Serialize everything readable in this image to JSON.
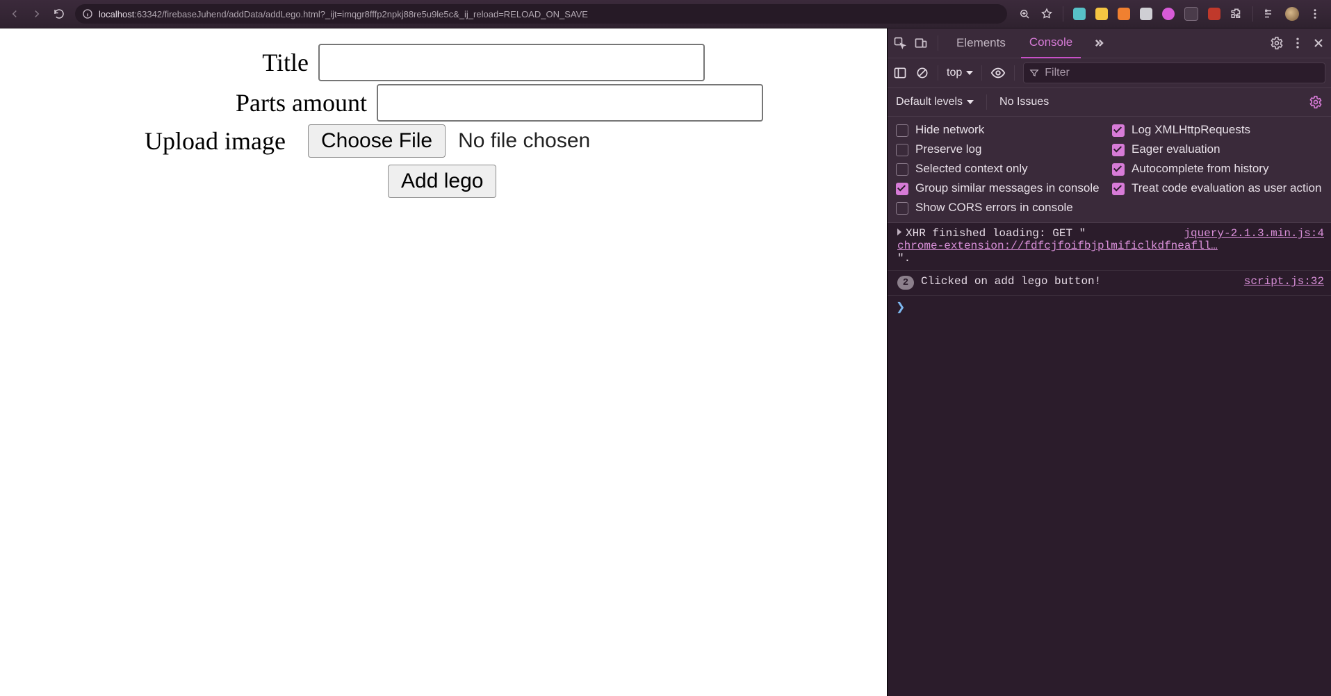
{
  "browser": {
    "url_host": "localhost",
    "url_rest": ":63342/firebaseJuhend/addData/addLego.html?_ijt=imqgr8fffp2npkj88re5u9le5c&_ij_reload=RELOAD_ON_SAVE"
  },
  "page": {
    "title_label": "Title",
    "parts_label": "Parts amount",
    "upload_label": "Upload image",
    "choose_file_label": "Choose File",
    "no_file_text": "No file chosen",
    "submit_label": "Add lego"
  },
  "devtools": {
    "tabs": {
      "elements": "Elements",
      "console": "Console"
    },
    "toolbar": {
      "top": "top",
      "filter_placeholder": "Filter"
    },
    "levels": {
      "default_levels": "Default levels",
      "no_issues": "No Issues"
    },
    "settings": [
      {
        "label": "Hide network",
        "checked": false
      },
      {
        "label": "Log XMLHttpRequests",
        "checked": true
      },
      {
        "label": "Preserve log",
        "checked": false
      },
      {
        "label": "Eager evaluation",
        "checked": true
      },
      {
        "label": "Selected context only",
        "checked": false
      },
      {
        "label": "Autocomplete from history",
        "checked": true
      },
      {
        "label": "Group similar messages in console",
        "checked": true
      },
      {
        "label": "Treat code evaluation as user action",
        "checked": true
      },
      {
        "label": "Show CORS errors in console",
        "checked": false
      }
    ],
    "log": {
      "xhr": {
        "prefix": "XHR finished loading: GET \"",
        "source": "jquery-2.1.3.min.js:4",
        "url": "chrome-extension://fdfcjfoifbjplmificlkdfneafll…",
        "suffix": "\"."
      },
      "click": {
        "count": "2",
        "text": "Clicked on add lego button!",
        "source": "script.js:32"
      }
    }
  }
}
